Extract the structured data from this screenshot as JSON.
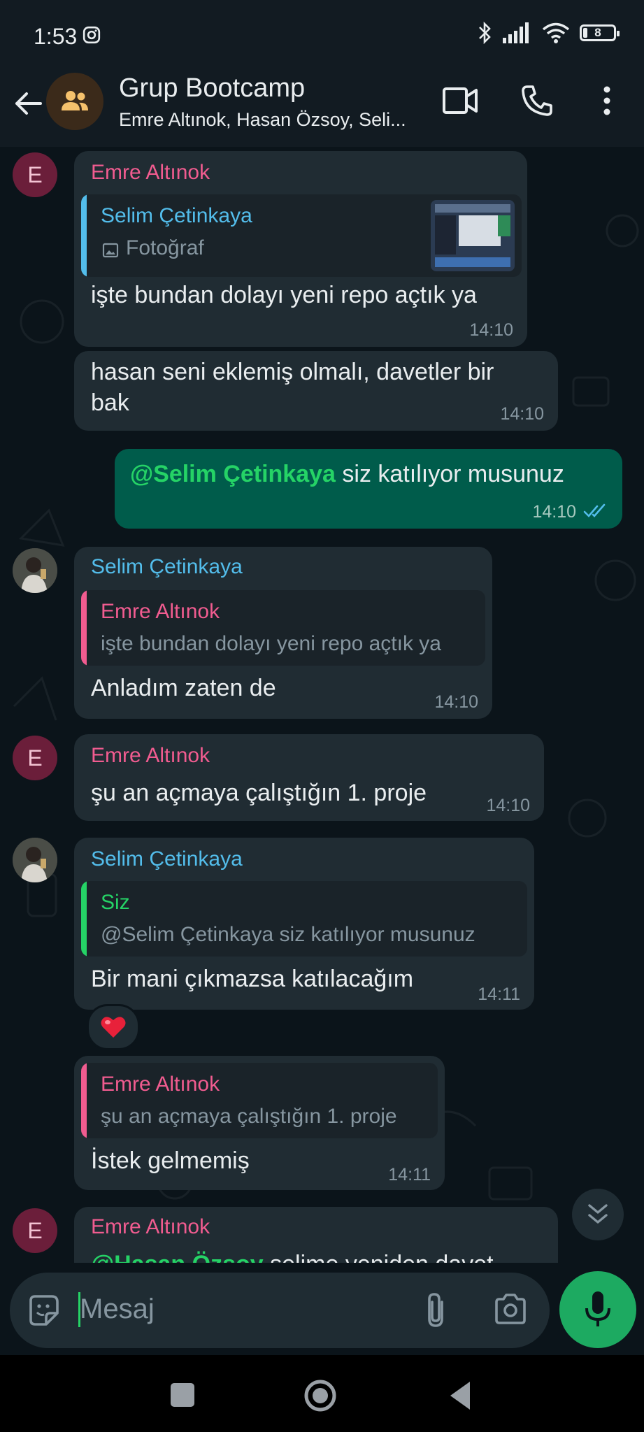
{
  "status_bar": {
    "time": "1:53",
    "battery": "8"
  },
  "header": {
    "title": "Grup Bootcamp",
    "subtitle": "Emre Altınok, Hasan Özsoy, Seli..."
  },
  "messages": [
    {
      "sender": "Emre Altınok",
      "quote_name": "Selim Çetinkaya",
      "quote_text": "Fotoğraf",
      "text": "işte bundan dolayı yeni repo açtık ya",
      "time": "14:10",
      "avatar": "E"
    },
    {
      "text_1": "hasan seni eklemiş olmalı, davetler bir",
      "text_2": "bak",
      "time": "14:10"
    },
    {
      "mention": "@Selim Çetinkaya",
      "text": " siz katılıyor musunuz",
      "time": "14:10"
    },
    {
      "sender": "Selim Çetinkaya",
      "quote_name": "Emre Altınok",
      "quote_text": "işte bundan dolayı yeni repo açtık ya",
      "text": "Anladım zaten de",
      "time": "14:10"
    },
    {
      "sender": "Emre Altınok",
      "text": "şu an açmaya çalıştığın 1. proje",
      "time": "14:10",
      "avatar": "E"
    },
    {
      "sender": "Selim Çetinkaya",
      "quote_name": "Siz",
      "quote_text": "@Selim Çetinkaya  siz katılıyor musunuz",
      "text": "Bir mani çıkmazsa katılacağım",
      "time": "14:11",
      "reaction": "❤️"
    },
    {
      "quote_name": "Emre Altınok",
      "quote_text": "şu an açmaya çalıştığın 1. proje",
      "text": "İstek gelmemiş",
      "time": "14:11"
    },
    {
      "sender": "Emre Altınok",
      "text_partial_mention": "@Hasan Özsoy",
      "text_partial": " selime yeniden davet",
      "avatar": "E"
    }
  ],
  "input": {
    "placeholder": "Mesaj"
  },
  "colors": {
    "accent": "#25d366",
    "outgoing": "#005c4b",
    "incoming": "#202c33",
    "emre": "#f15c90",
    "selim": "#53bdeb"
  }
}
